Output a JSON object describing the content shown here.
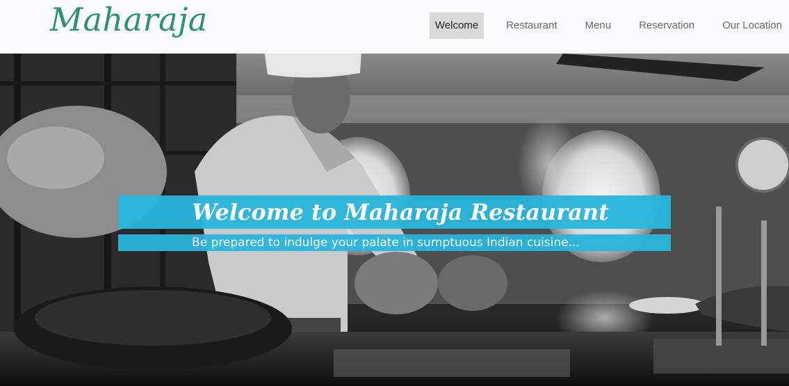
{
  "header": {
    "logo_text": "Maharaja",
    "nav": [
      {
        "label": "Welcome",
        "active": true
      },
      {
        "label": "Restaurant",
        "active": false
      },
      {
        "label": "Menu",
        "active": false
      },
      {
        "label": "Reservation",
        "active": false
      },
      {
        "label": "Our Location",
        "active": false
      }
    ]
  },
  "hero": {
    "title": "Welcome to Maharaja Restaurant",
    "subtitle": "Be prepared to indulge your palate in sumptuous Indian cuisine...",
    "image_description": "black-and-white kitchen scene with chef",
    "banner_color": "#29b6dc"
  },
  "colors": {
    "logo": "#2f8f7a",
    "nav_active_bg": "#d9d9d9",
    "nav_text": "#6b6b6b",
    "navbar_bg": "#f8f9fa"
  }
}
